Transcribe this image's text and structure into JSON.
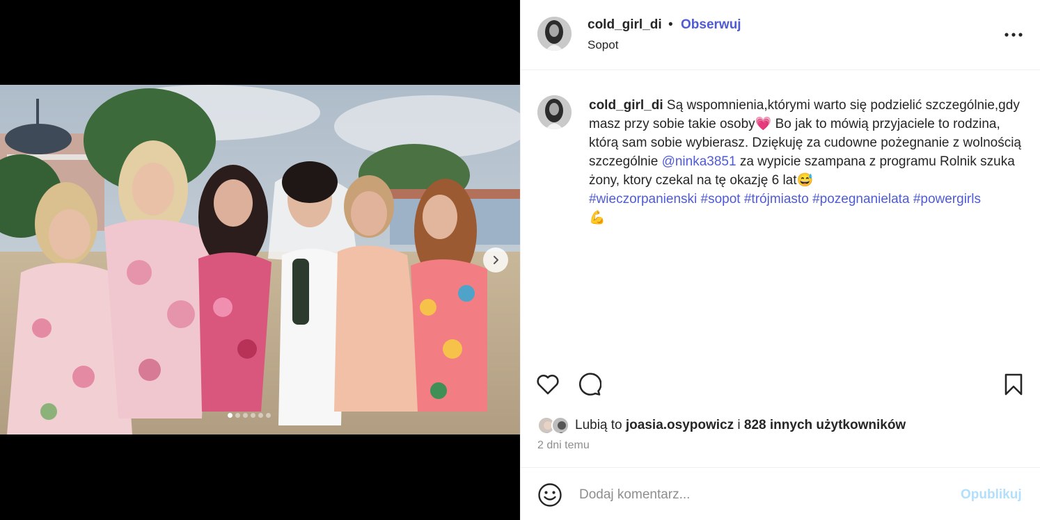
{
  "post": {
    "username": "cold_girl_di",
    "separator": "•",
    "follow_label": "Obserwuj",
    "location": "Sopot",
    "more_icon": "more-horizontal-icon"
  },
  "media": {
    "next_icon": "chevron-right-icon",
    "dots_total": 6,
    "dots_active_index": 0
  },
  "caption": {
    "username": "cold_girl_di",
    "text_1": " Są wspomnienia,którymi warto się podzielić szczególnie,gdy masz przy sobie takie osoby",
    "emoji_heart": "💗",
    "text_2": " Bo jak to mówią przyjaciele to rodzina, którą sam sobie wybierasz. Dziękuję za cudowne pożegnanie z wolnością szczególnie ",
    "mention": "@ninka3851",
    "text_3": " za wypicie szampana z programu Rolnik szuka żony, ktory czekal na tę okazję 6 lat",
    "emoji_smile": "😅",
    "hashtags": [
      "#wieczorpanienski",
      "#sopot",
      "#trójmiasto",
      "#pozegnanielata",
      "#powergirls"
    ],
    "emoji_muscle": "💪"
  },
  "actions": {
    "like_icon": "heart-icon",
    "comment_icon": "comment-icon",
    "save_icon": "bookmark-icon"
  },
  "likes": {
    "prefix": "Lubią to ",
    "user": "joasia.osypowicz",
    "middle": " i ",
    "others": "828 innych użytkowników"
  },
  "time": "2 dni temu",
  "comment": {
    "emoji_icon": "smiley-icon",
    "placeholder": "Dodaj komentarz...",
    "publish_label": "Opublikuj"
  },
  "colors": {
    "link": "#4f5bd5",
    "publish_disabled": "#b2dffc",
    "muted": "#8e8e8e"
  }
}
